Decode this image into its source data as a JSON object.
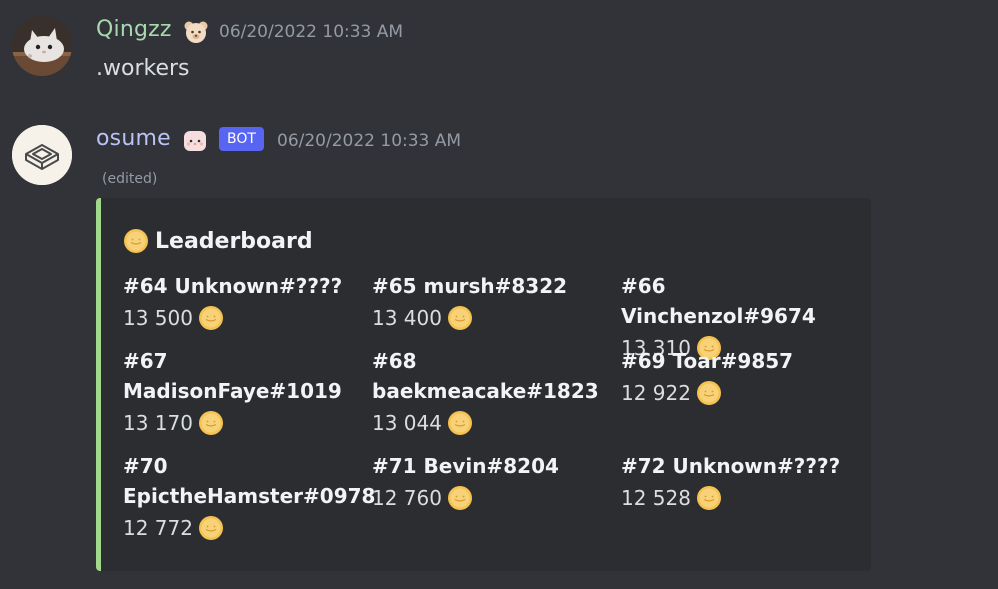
{
  "messages": [
    {
      "username": "Qingzz",
      "badge_icon": "bear-face-emoji",
      "timestamp": "06/20/2022 10:33 AM",
      "content": ".workers",
      "avatar_icon": "cat-avatar"
    },
    {
      "username": "osume",
      "badge_icon": "pink-blob-emoji",
      "bot_tag": "BOT",
      "timestamp": "06/20/2022 10:33 AM",
      "edited": "(edited)",
      "avatar_icon": "keyboard-key-avatar",
      "embed": {
        "accent_color": "#a2d88b",
        "title": "Leaderboard",
        "title_icon": "coin-icon",
        "fields": [
          {
            "name": "#64 Unknown#????",
            "value": "13 500"
          },
          {
            "name": "#65 mursh#8322",
            "value": "13 400"
          },
          {
            "name": "#66 Vinchenzol#9674",
            "value": "13 310"
          },
          {
            "name": "#67 MadisonFaye#1019",
            "value": "13 170"
          },
          {
            "name": "#68 baekmeacake#1823",
            "value": "13 044"
          },
          {
            "name": "#69 Toar#9857",
            "value": "12 922"
          },
          {
            "name": "#70 EpictheHamster#0978",
            "value": "12 772"
          },
          {
            "name": "#71 Bevin#8204",
            "value": "12 760"
          },
          {
            "name": "#72 Unknown#????",
            "value": "12 528"
          }
        ]
      }
    }
  ],
  "colors": {
    "background": "#313338",
    "embed_background": "#2b2d31",
    "bot_tag": "#5865f2",
    "username_1": "#a8d7b0",
    "username_2": "#b9c3f4",
    "coin": "#f6c24f"
  }
}
